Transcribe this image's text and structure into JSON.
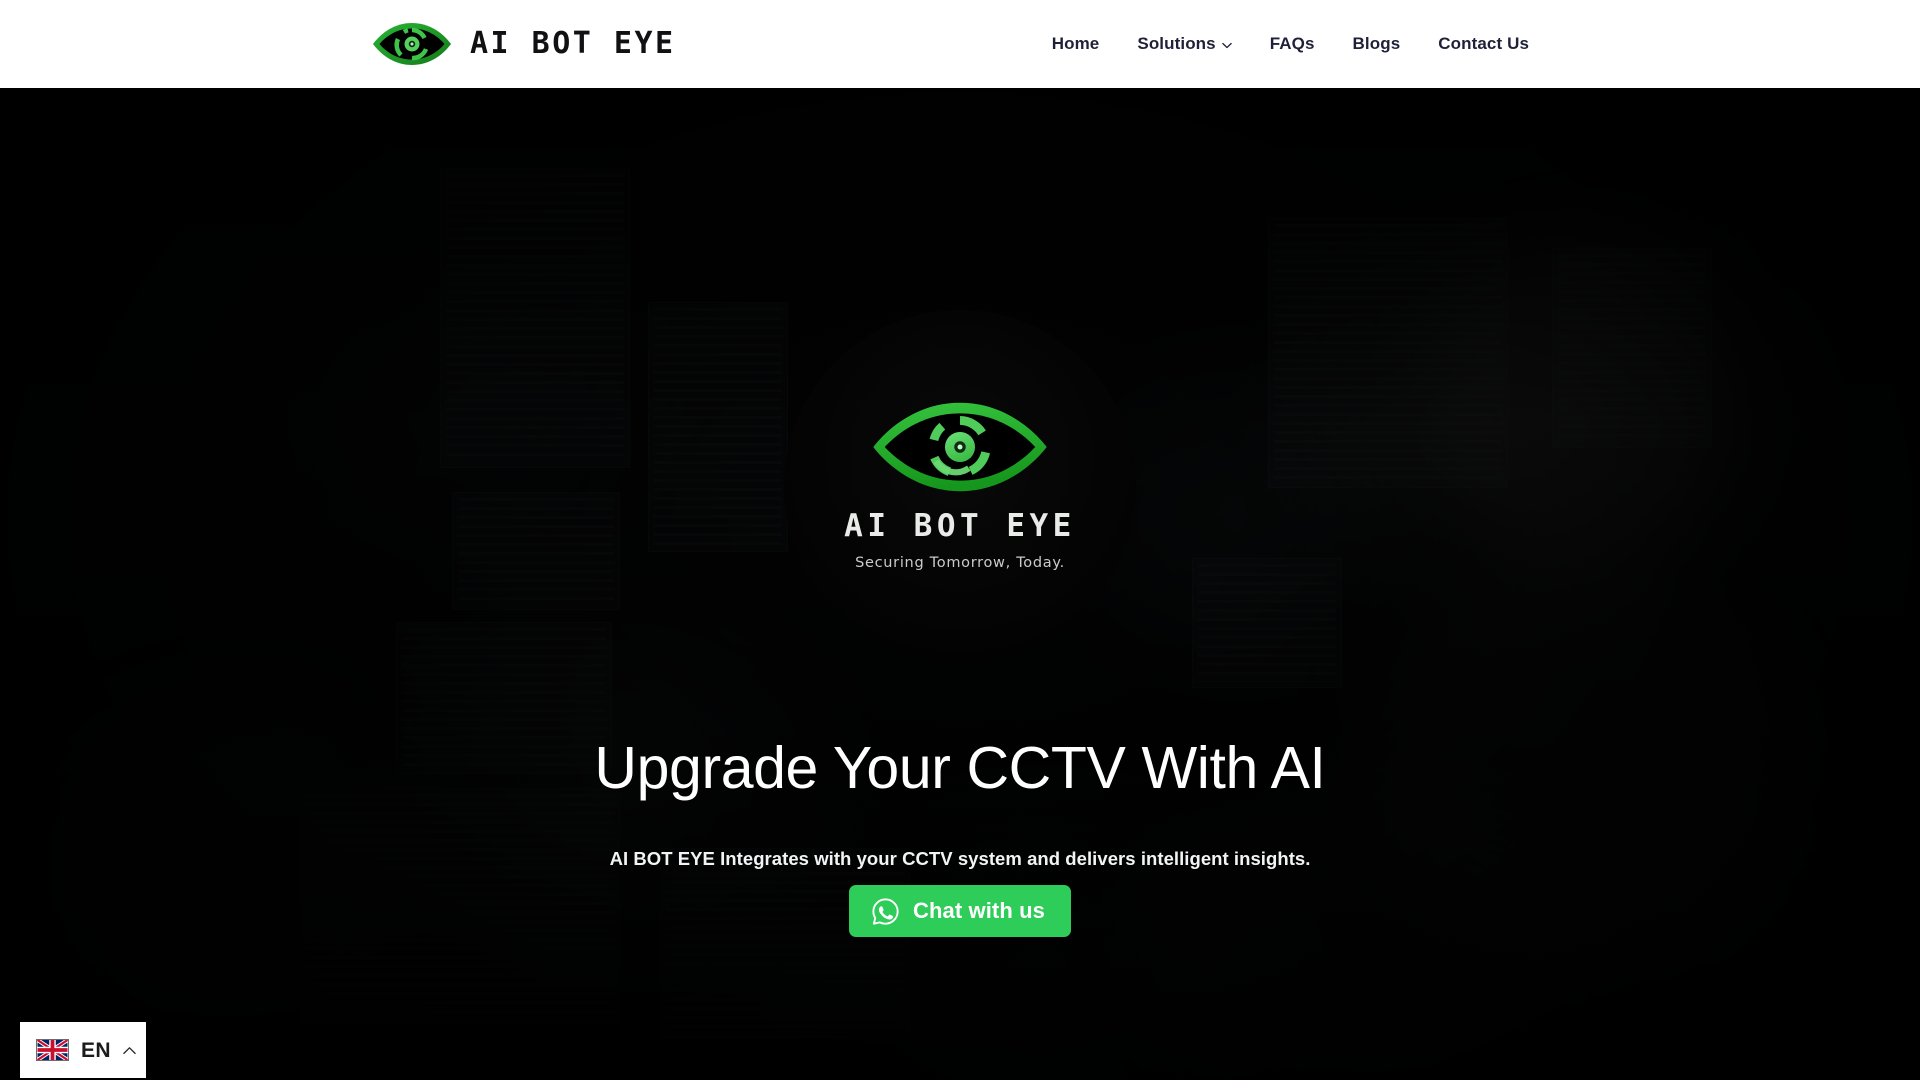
{
  "header": {
    "logo_icon": "eye-logo-icon",
    "brand_name": "AI BOT EYE",
    "nav": [
      {
        "label": "Home",
        "icon": null,
        "name": "nav-home"
      },
      {
        "label": "Solutions",
        "icon": "chevron-down-icon",
        "name": "nav-solutions"
      },
      {
        "label": "FAQs",
        "icon": null,
        "name": "nav-faqs"
      },
      {
        "label": "Blogs",
        "icon": null,
        "name": "nav-blogs"
      },
      {
        "label": "Contact Us",
        "icon": null,
        "name": "nav-contact-us"
      }
    ]
  },
  "hero": {
    "badge": {
      "icon": "eye-logo-icon",
      "title": "AI BOT EYE",
      "tagline": "Securing Tomorrow, Today."
    },
    "title": "Upgrade Your CCTV With AI",
    "subtitle": "AI BOT EYE Integrates with your CCTV system and delivers intelligent insights.",
    "cta": {
      "label": "Chat with us",
      "icon": "whatsapp-icon"
    }
  },
  "language_switcher": {
    "flag_icon": "uk-flag-icon",
    "code": "EN",
    "chevron_icon": "chevron-up-icon"
  },
  "colors": {
    "brand_green_dark": "#1e9e28",
    "brand_green_mid": "#2fb83a",
    "brand_green_light": "#5ed96a",
    "whatsapp_green": "#2ecc58",
    "header_bg": "#ffffff",
    "nav_text": "#1f2138",
    "hero_bg": "#050506",
    "hero_title": "#ffffff"
  }
}
